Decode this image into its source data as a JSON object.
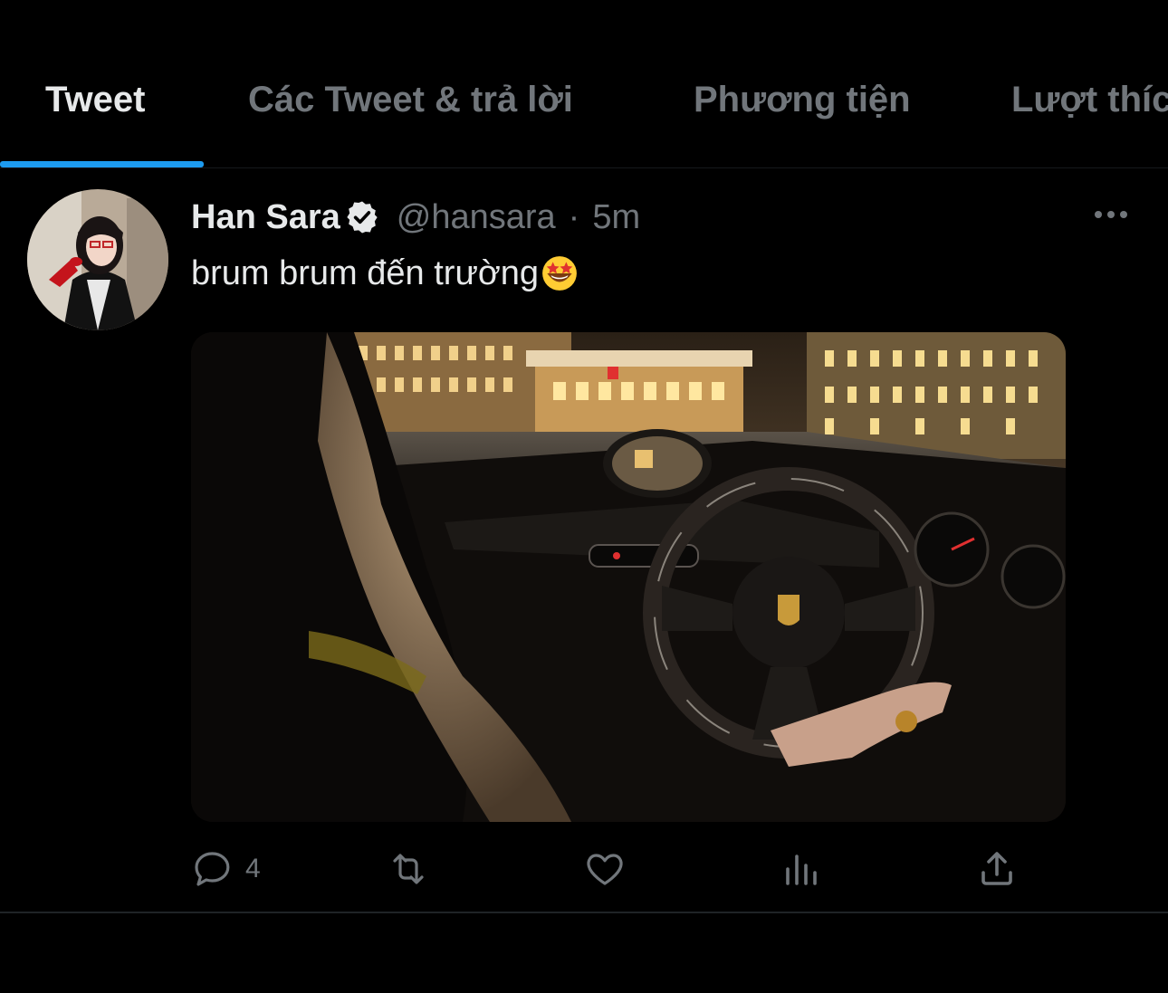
{
  "tabs": [
    {
      "label": "Tweet",
      "active": true
    },
    {
      "label": "Các Tweet & trả lời",
      "active": false
    },
    {
      "label": "Phương tiện",
      "active": false
    },
    {
      "label": "Lượt thích",
      "active": false
    }
  ],
  "tweet": {
    "display_name": "Han Sara",
    "verified": true,
    "handle": "@hansara",
    "separator": "·",
    "time": "5m",
    "text": "brum brum đến trường",
    "emoji": "star-struck-emoji",
    "media": {
      "type": "image",
      "subject": "car-interior-night-driving"
    },
    "actions": {
      "reply": {
        "icon": "reply-icon",
        "count": "4"
      },
      "retweet": {
        "icon": "retweet-icon",
        "count": ""
      },
      "like": {
        "icon": "heart-icon",
        "count": ""
      },
      "views": {
        "icon": "analytics-icon",
        "count": ""
      },
      "share": {
        "icon": "share-icon",
        "count": ""
      }
    }
  },
  "colors": {
    "background": "#000000",
    "accent": "#1d9bf0",
    "text_primary": "#e7e9ea",
    "text_secondary": "#71767b"
  }
}
